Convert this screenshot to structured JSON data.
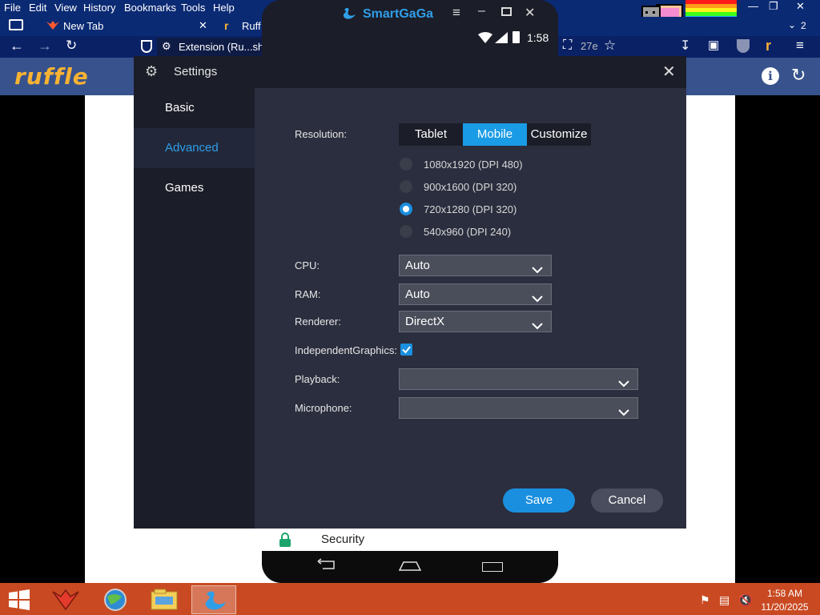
{
  "browser": {
    "menu": [
      "File",
      "Edit",
      "View",
      "History",
      "Bookmarks",
      "Tools",
      "Help"
    ],
    "tabs": [
      {
        "label": "New Tab"
      },
      {
        "label": "Ruff"
      }
    ],
    "url": "Extension (Ru...sh",
    "url_right": "27e",
    "tab_count": "2",
    "ruffle_logo": "ruffle"
  },
  "emulator": {
    "title": "SmartGaGa",
    "status_time": "1:58",
    "security_label": "Security"
  },
  "settings": {
    "title": "Settings",
    "sidebar": [
      {
        "label": "Basic",
        "active": false
      },
      {
        "label": "Advanced",
        "active": true
      },
      {
        "label": "Games",
        "active": false
      }
    ],
    "resolution_label": "Resolution:",
    "segments": [
      {
        "label": "Tablet",
        "active": false
      },
      {
        "label": "Mobile",
        "active": true
      },
      {
        "label": "Customize",
        "active": false
      }
    ],
    "resolutions": [
      {
        "label": "1080x1920 (DPI 480)",
        "checked": false
      },
      {
        "label": "900x1600 (DPI 320)",
        "checked": false
      },
      {
        "label": "720x1280 (DPI 320)",
        "checked": true
      },
      {
        "label": "540x960 (DPI 240)",
        "checked": false
      }
    ],
    "cpu_label": "CPU:",
    "cpu_value": "Auto",
    "ram_label": "RAM:",
    "ram_value": "Auto",
    "renderer_label": "Renderer:",
    "renderer_value": "DirectX",
    "independent_label": "IndependentGraphics:",
    "independent_checked": true,
    "playback_label": "Playback:",
    "playback_value": "",
    "microphone_label": "Microphone:",
    "microphone_value": "",
    "save_label": "Save",
    "cancel_label": "Cancel"
  },
  "taskbar": {
    "time": "1:58 AM",
    "date": "11/20/2025"
  },
  "colors": {
    "accent": "#1a9be6",
    "dialog_bg": "#2b2e3e",
    "sidebar_bg": "#1b1d28",
    "taskbar": "#c94a22"
  }
}
